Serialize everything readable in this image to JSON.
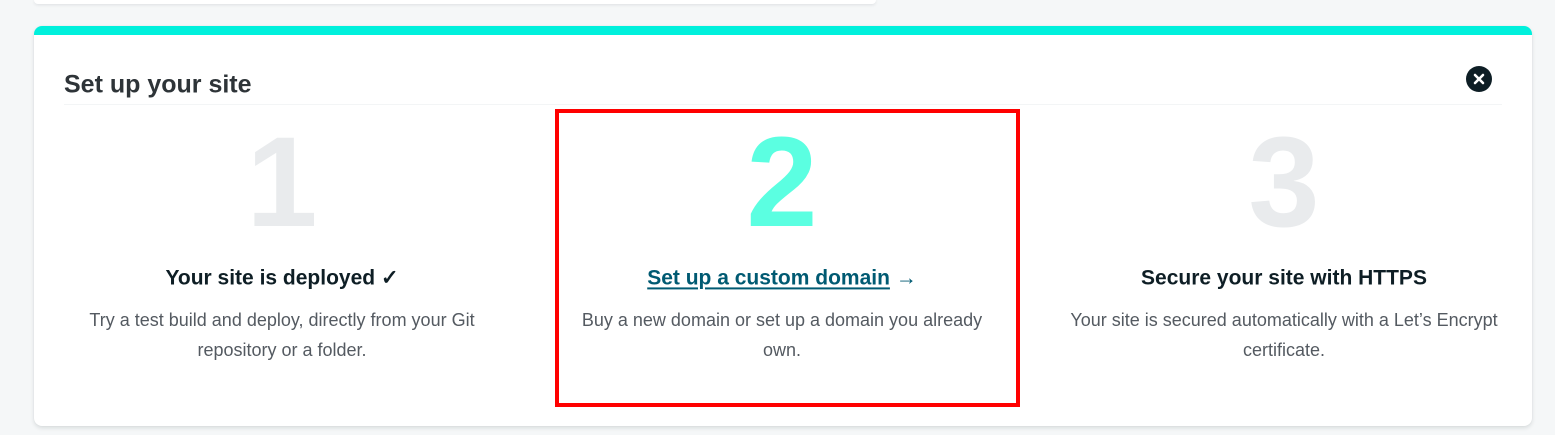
{
  "card": {
    "title": "Set up your site",
    "accent_color": "#00f0dc",
    "close_icon": "close-icon"
  },
  "steps": [
    {
      "number": "1",
      "heading": "Your site is deployed",
      "heading_suffix": "✓",
      "description": "Try a test build and deploy, directly from your Git repository or a folder.",
      "state": "complete"
    },
    {
      "number": "2",
      "link_text": "Set up a custom domain",
      "heading_suffix": "→",
      "description": "Buy a new domain or set up a domain you already own.",
      "state": "current"
    },
    {
      "number": "3",
      "heading": "Secure your site with HTTPS",
      "description": "Your site is secured automatically with a Let’s Encrypt certificate.",
      "state": "upcoming"
    }
  ],
  "colors": {
    "active_number": "#5bffe1",
    "inactive_number": "#e9ebed",
    "link": "#005a72",
    "highlight": "#ff0000"
  }
}
